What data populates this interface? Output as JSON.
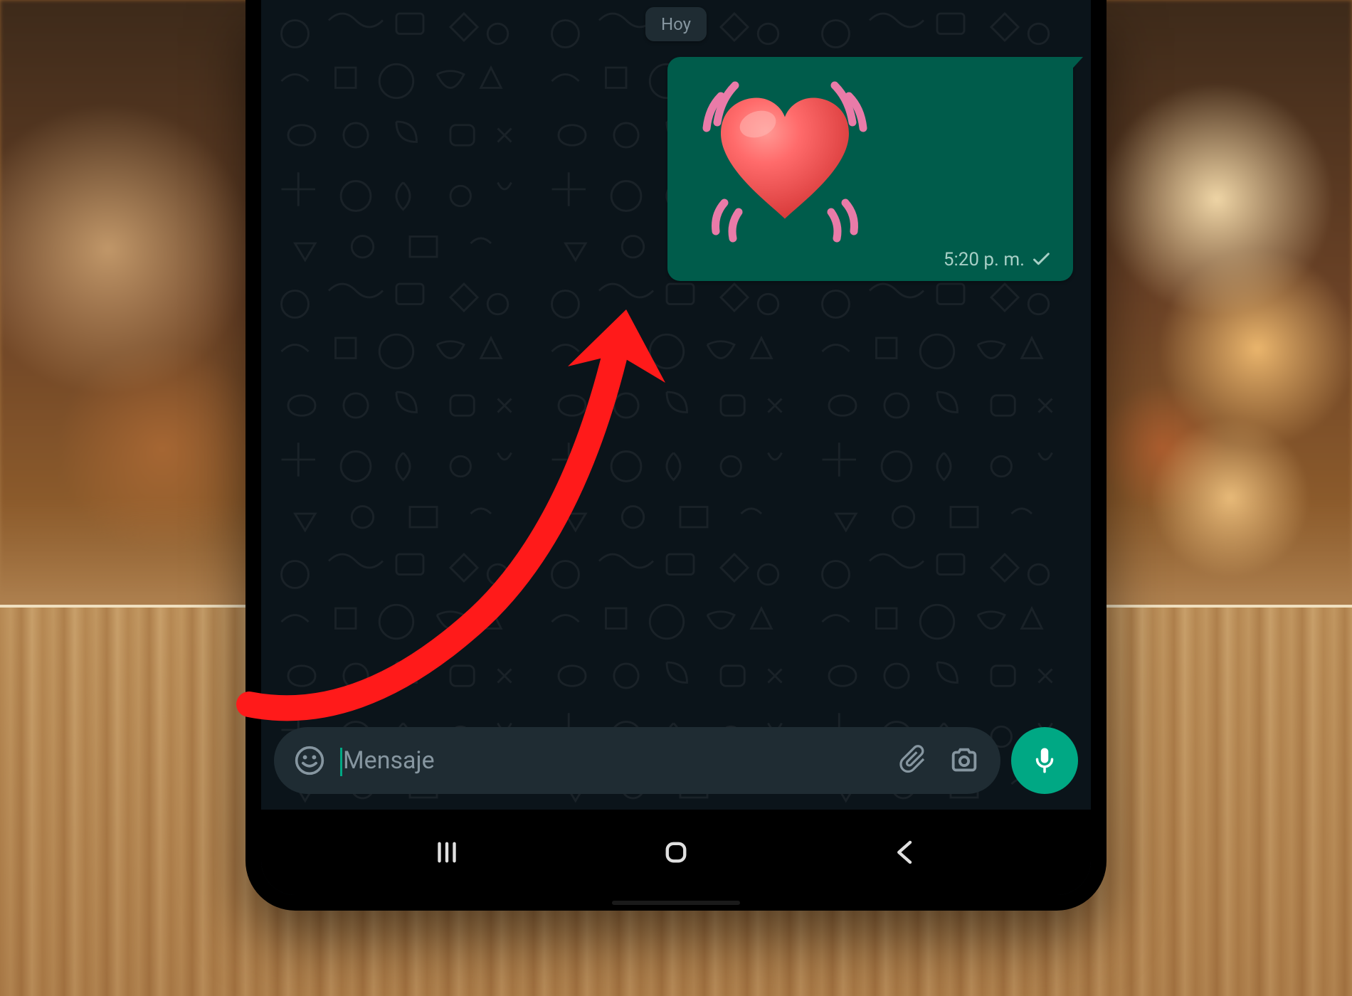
{
  "chat": {
    "date_label": "Hoy",
    "message": {
      "emoji_name": "beating-heart",
      "time": "5:20 p. m.",
      "status_icon": "check-single"
    }
  },
  "input": {
    "placeholder": "Mensaje",
    "emoji_icon": "emoji-smile",
    "attach_icon": "paperclip",
    "camera_icon": "camera",
    "mic_icon": "microphone"
  },
  "nav": {
    "recents_icon": "recents",
    "home_icon": "home",
    "back_icon": "back"
  },
  "colors": {
    "bubble_out": "#005c4b",
    "accent": "#00a884",
    "screen_bg": "#0b141a",
    "input_bg": "#1f2c33",
    "text_muted": "#8696a0",
    "annotation": "#ff0000"
  }
}
